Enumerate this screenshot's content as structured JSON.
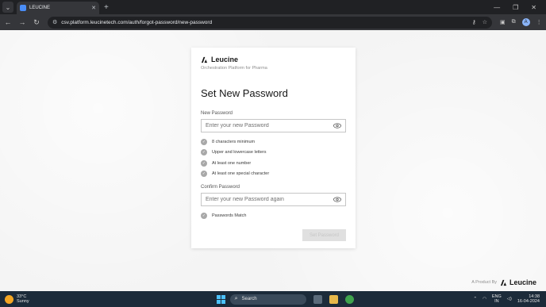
{
  "browser": {
    "tab_title": "LEUCINE",
    "url": "csv.platform.leucinetech.com/auth/forgot-password/new-password",
    "profile_initial": "A"
  },
  "card": {
    "brand": "Leucine",
    "tagline": "Orchestration Platform for Pharma",
    "heading": "Set New Password",
    "new_password_label": "New Password",
    "new_password_placeholder": "Enter your new Password",
    "rules": [
      "8 characters minimum",
      "Upper and lowercase letters",
      "At least one number",
      "At least one special character"
    ],
    "confirm_label": "Confirm Password",
    "confirm_placeholder": "Enter your new Password again",
    "match_rule": "Passwords Match",
    "submit_label": "Set Password"
  },
  "footer": {
    "product_by": "A Product By",
    "brand": "Leucine"
  },
  "taskbar": {
    "temperature": "33°C",
    "weather": "Sunny",
    "search_label": "Search",
    "lang_top": "ENG",
    "lang_bottom": "IN",
    "time": "14:38",
    "date": "16-04-2024"
  },
  "colors": {
    "accent": "#4cc2ff",
    "check": "#a8a8a8",
    "disabled_button": "#e0e0e0"
  }
}
